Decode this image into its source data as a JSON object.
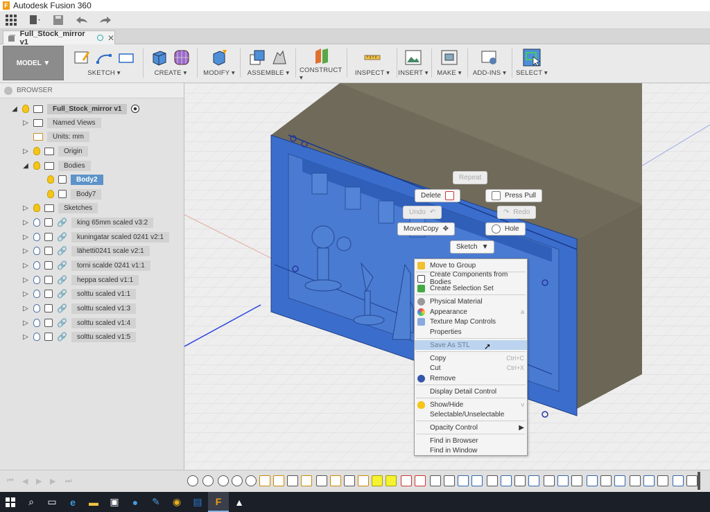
{
  "window": {
    "title": "Autodesk Fusion 360",
    "app_icon": "F"
  },
  "doc_tab": {
    "label": "Full_Stock_mirror v1"
  },
  "toolbar": {
    "workspace": "MODEL ▼",
    "groups": [
      "SKETCH ▾",
      "CREATE ▾",
      "MODIFY ▾",
      "ASSEMBLE ▾",
      "CONSTRUCT ▾",
      "INSPECT ▾",
      "INSERT ▾",
      "MAKE ▾",
      "ADD-INS ▾",
      "SELECT ▾"
    ]
  },
  "browser": {
    "title": "BROWSER",
    "root": "Full_Stock_mirror v1",
    "items": [
      "Named Views",
      "Units: mm",
      "Origin",
      "Bodies",
      "Body2",
      "Body7",
      "Sketches",
      "king 65mm scaled v3:2",
      "kuningatar scaled 0241 v2:1",
      "lähetti0241 scale v2:1",
      "torni scalde 0241 v1:1",
      "heppa scaled v1:1",
      "solttu scaled v1:1",
      "solttu scaled v1:3",
      "solttu scaled v1:4",
      "solttu scaled v1:5"
    ]
  },
  "marking_menu": {
    "repeat": "Repeat",
    "delete": "Delete",
    "press_pull": "Press Pull",
    "undo": "Undo",
    "redo": "Redo",
    "move_copy": "Move/Copy",
    "hole": "Hole",
    "sketch": "Sketch"
  },
  "context_menu": {
    "items": [
      "Move to Group",
      "Create Components from Bodies",
      "Create Selection Set",
      "Physical Material",
      "Appearance",
      "Texture Map Controls",
      "Properties",
      "Save As STL",
      "Copy",
      "Cut",
      "Remove",
      "Display Detail Control",
      "Show/Hide",
      "Selectable/Unselectable",
      "Opacity Control",
      "Find in Browser",
      "Find in Window"
    ],
    "shortcuts": {
      "appearance": "a",
      "copy": "Ctrl+C",
      "cut": "Ctrl+X",
      "showhide": "v"
    }
  },
  "colors": {
    "accent": "#5c93c9",
    "body_blue": "#3a6ec9",
    "stock_gray": "#77705e",
    "highlight": "#f5f231"
  }
}
